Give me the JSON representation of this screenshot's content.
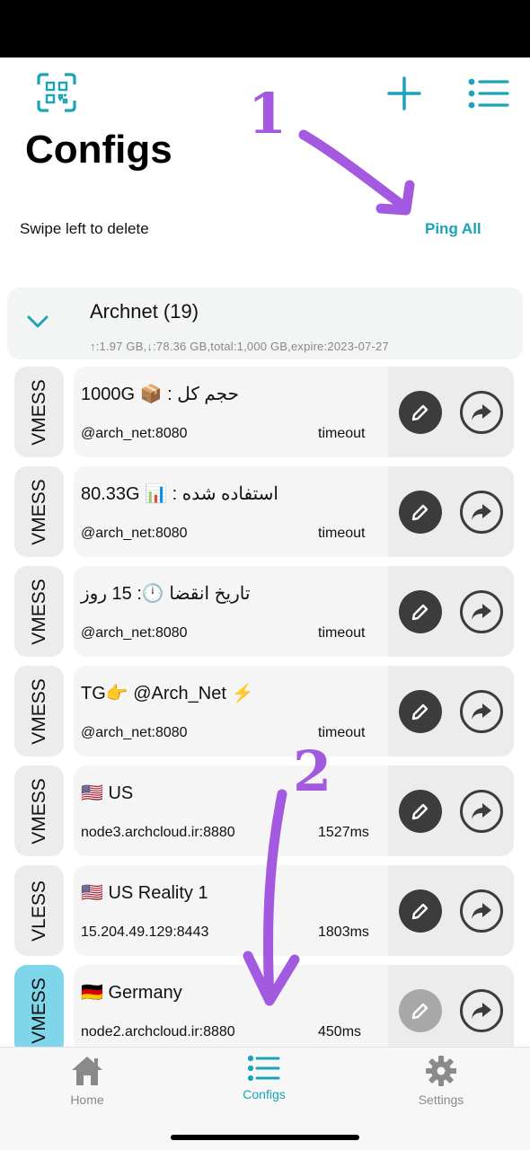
{
  "header": {
    "title": "Configs",
    "hint": "Swipe left to delete",
    "ping_all_label": "Ping All",
    "icons": {
      "left": "qr-scan-icon",
      "add": "plus-icon",
      "menu": "list-icon"
    },
    "accent_color": "#1ba3b8"
  },
  "annotations": {
    "first": "1",
    "second": "2",
    "color": "#a35ae0"
  },
  "group": {
    "name": "Archnet (19)",
    "stats": "↑:1.97 GB,↓:78.36 GB,total:1,000 GB,expire:2023-07-27",
    "expanded": true
  },
  "configs": [
    {
      "protocol": "VMESS",
      "name": "حجم کل : 📦 1000G",
      "address": "@arch_net:8080",
      "status": "timeout",
      "active": false
    },
    {
      "protocol": "VMESS",
      "name": "استفاده شده : 📊 80.33G",
      "address": "@arch_net:8080",
      "status": "timeout",
      "active": false
    },
    {
      "protocol": "VMESS",
      "name": "تاریخ انقضا 🕛: 15 روز",
      "address": "@arch_net:8080",
      "status": "timeout",
      "active": false
    },
    {
      "protocol": "VMESS",
      "name": "TG👉 @Arch_Net ⚡",
      "address": "@arch_net:8080",
      "status": "timeout",
      "active": false
    },
    {
      "protocol": "VMESS",
      "name": "🇺🇸 US",
      "address": "node3.archcloud.ir:8880",
      "status": "1527ms",
      "active": false
    },
    {
      "protocol": "VLESS",
      "name": "🇺🇸 US Reality 1",
      "address": "15.204.49.129:8443",
      "status": "1803ms",
      "active": false
    },
    {
      "protocol": "VMESS",
      "name": "🇩🇪 Germany",
      "address": "node2.archcloud.ir:8880",
      "status": "450ms",
      "active": true
    }
  ],
  "tabbar": {
    "items": [
      {
        "label": "Home",
        "icon": "home-icon",
        "active": false
      },
      {
        "label": "Configs",
        "icon": "list-icon",
        "active": true
      },
      {
        "label": "Settings",
        "icon": "gear-icon",
        "active": false
      }
    ]
  }
}
